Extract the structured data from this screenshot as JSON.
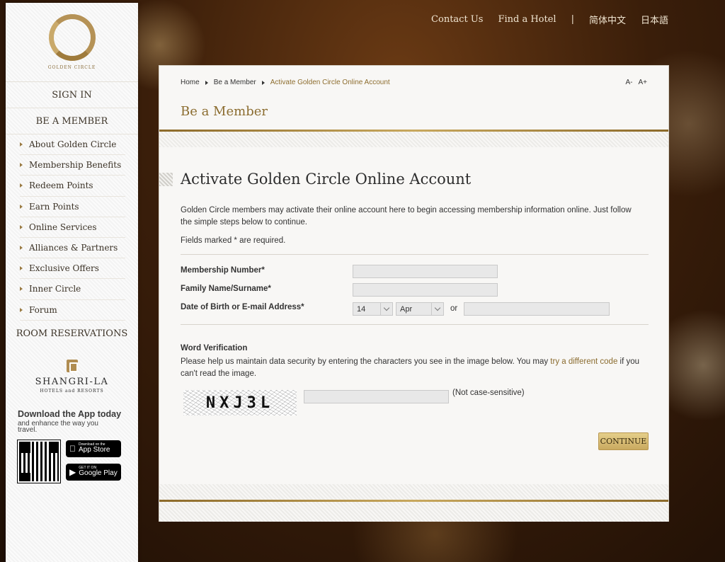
{
  "top_links": {
    "contact": "Contact Us",
    "find_hotel": "Find a Hotel",
    "separator": "|",
    "chinese": "简体中文",
    "japanese": "日本語"
  },
  "sidebar": {
    "logo_text": "GOLDEN CIRCLE",
    "sign_in": "SIGN IN",
    "be_member": "BE A MEMBER",
    "items": [
      {
        "label": "About Golden Circle"
      },
      {
        "label": "Membership Benefits"
      },
      {
        "label": "Redeem Points"
      },
      {
        "label": "Earn Points"
      },
      {
        "label": "Online Services"
      },
      {
        "label": "Alliances & Partners"
      },
      {
        "label": "Exclusive Offers"
      },
      {
        "label": "Inner Circle"
      },
      {
        "label": "Forum"
      }
    ],
    "room_reservations": "ROOM RESERVATIONS",
    "brand_name": "SHANGRI-LA",
    "brand_sub": "HOTELS and RESORTS",
    "app_title": "Download the App today",
    "app_sub": "and enhance the way you travel.",
    "app_store_small": "Download on the",
    "app_store_big": "App Store",
    "google_small": "GET IT ON",
    "google_big": "Google Play"
  },
  "breadcrumb": {
    "home": "Home",
    "be_member": "Be a Member",
    "current": "Activate Golden Circle Online Account"
  },
  "font_size": {
    "decrease": "A-",
    "increase": "A+"
  },
  "section_title": "Be a Member",
  "page_heading": "Activate Golden Circle Online Account",
  "intro": "Golden Circle members may activate their online account here to begin accessing membership information online. Just follow the simple steps below to continue.",
  "required_note": "Fields marked * are required.",
  "form": {
    "membership_label": "Membership Number*",
    "membership_value": "",
    "surname_label": "Family Name/Surname*",
    "surname_value": "",
    "dob_label": "Date of Birth or E-mail Address*",
    "dob_day": "14",
    "dob_month": "Apr",
    "or_text": "or",
    "email_value": ""
  },
  "verification": {
    "title": "Word Verification",
    "text_before": "Please help us maintain data security by entering the characters you see in the image below. You may ",
    "link": "try a different code",
    "text_after": " if you can't read the image.",
    "captcha_text": "NXJ3L",
    "input_value": "",
    "case_note": "(Not case-sensitive)"
  },
  "continue_label": "CONTINUE",
  "colors": {
    "gold": "#8b6c2f",
    "button": "#d9bd74"
  }
}
